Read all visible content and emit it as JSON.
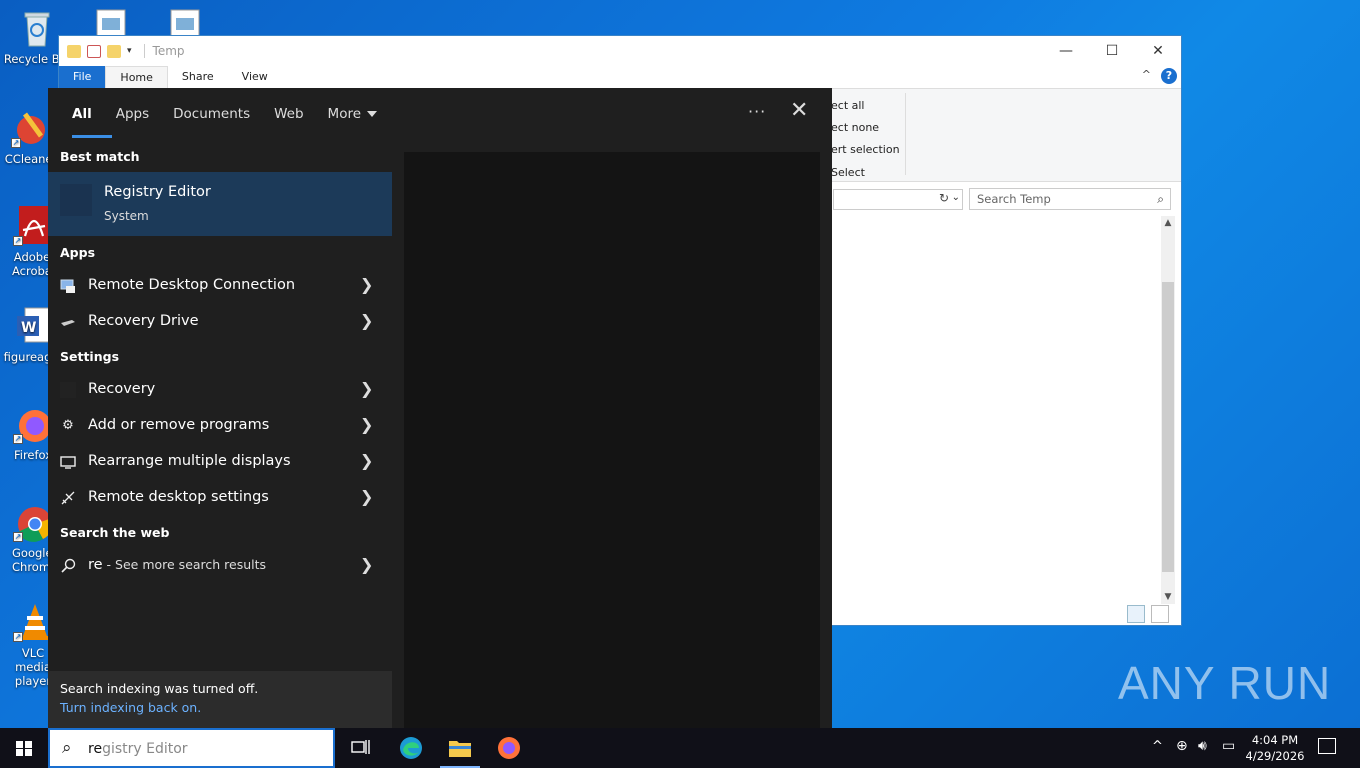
{
  "desktop": {
    "icons": [
      {
        "label": "Recycle Bin"
      },
      {
        "label": "CCleaner"
      },
      {
        "label": "Adobe Acrobat"
      },
      {
        "label": "figureag..."
      },
      {
        "label": "Firefox"
      },
      {
        "label": "Google Chrome"
      },
      {
        "label": "VLC media player"
      }
    ]
  },
  "explorer": {
    "title": "Temp",
    "tabs": [
      "File",
      "Home",
      "Share",
      "View"
    ],
    "ribbon_items": [
      "ect all",
      "ect none",
      "ert selection",
      "Select"
    ],
    "search_placeholder": "Search Temp",
    "help_label": "?"
  },
  "search_panel": {
    "tabs": [
      "All",
      "Apps",
      "Documents",
      "Web",
      "More"
    ],
    "more_options": "···",
    "close": "✕",
    "best_match_heading": "Best match",
    "best_match": {
      "name": "Registry Editor",
      "type": "System"
    },
    "apps_heading": "Apps",
    "apps": [
      {
        "label": "Remote Desktop Connection",
        "icon": "remote-desktop-icon"
      },
      {
        "label": "Recovery Drive",
        "icon": "drive-icon"
      }
    ],
    "settings_heading": "Settings",
    "settings": [
      {
        "label": "Recovery",
        "icon": "recovery-icon"
      },
      {
        "label": "Add or remove programs",
        "icon": "gear-icon"
      },
      {
        "label": "Rearrange multiple displays",
        "icon": "monitor-icon"
      },
      {
        "label": "Remote desktop settings",
        "icon": "remote-settings-icon"
      }
    ],
    "web_heading": "Search the web",
    "web_query": "re",
    "web_suffix": " - See more search results",
    "footer_text": "Search indexing was turned off.",
    "footer_link": "Turn indexing back on."
  },
  "taskbar": {
    "search_typed": "re",
    "search_completion": "gistry Editor",
    "clock_time": "4:04 PM",
    "clock_date": "4/29/2026"
  },
  "watermark": "ANY RUN",
  "colors": {
    "accent": "#3b8fe6",
    "best_match_bg": "#1c3a59",
    "panel_bg": "#1f1f1f",
    "link": "#6cb2ff"
  }
}
